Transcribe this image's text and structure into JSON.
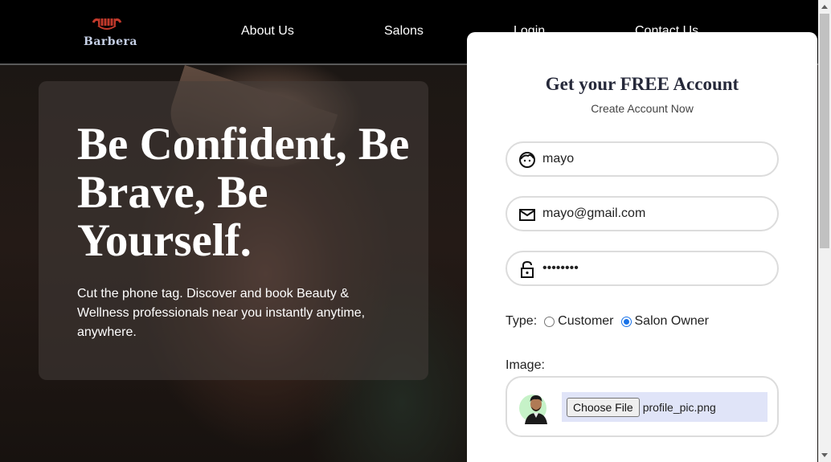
{
  "brand": {
    "logo_text": "Barbera"
  },
  "nav": {
    "about": "About Us",
    "salons": "Salons",
    "login": "Login",
    "contact": "Contact Us"
  },
  "hero": {
    "title": "Be Confident, Be Brave, Be Yourself.",
    "subtitle": "Cut the phone tag. Discover and book Beauty & Wellness professionals near you instantly anytime, anywhere."
  },
  "signup": {
    "title": "Get your FREE Account",
    "subtitle": "Create Account Now",
    "name_value": "mayo",
    "email_value": "mayo@gmail.com",
    "password_value": "••••••••",
    "type_label": "Type:",
    "type_options": [
      "Customer",
      "Salon Owner"
    ],
    "type_selected": "Salon Owner",
    "image_label": "Image:",
    "choose_file_label": "Choose File",
    "file_name": "profile_pic.png"
  },
  "icons": {
    "logo": "barber-pole-logo-icon",
    "name": "face-icon",
    "email": "mail-icon",
    "password": "lock-icon",
    "avatar": "profile-avatar"
  },
  "colors": {
    "nav_bg": "#000000",
    "panel_bg": "#ffffff",
    "title": "#26293a",
    "accent": "#1a73e8",
    "file_bg": "#e0e4f8"
  }
}
